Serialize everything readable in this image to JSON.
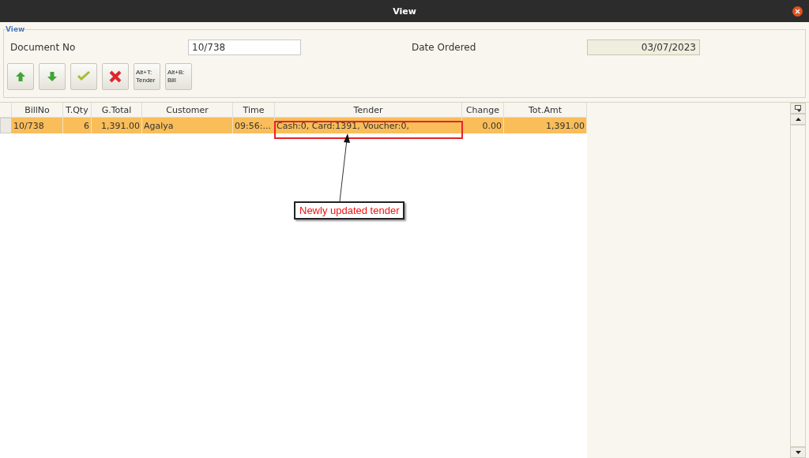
{
  "window": {
    "title": "View"
  },
  "group": {
    "title": "View"
  },
  "fields": [
    {
      "label": "Document No",
      "value": "10/738",
      "kind": "editable"
    },
    {
      "label": "Date Ordered",
      "value": "03/07/2023",
      "kind": "readonly"
    }
  ],
  "buttons": [
    {
      "kind": "up"
    },
    {
      "kind": "down"
    },
    {
      "kind": "ok"
    },
    {
      "kind": "cancel"
    },
    {
      "kind": "text",
      "lines": [
        "Alt+T:",
        "Tender"
      ]
    },
    {
      "kind": "text",
      "lines": [
        "Alt+B:",
        "Bill"
      ]
    }
  ],
  "table": {
    "columns": [
      {
        "label": "BillNo"
      },
      {
        "label": "T.Qty"
      },
      {
        "label": "G.Total"
      },
      {
        "label": "Customer"
      },
      {
        "label": "Time"
      },
      {
        "label": "Tender"
      },
      {
        "label": "Change"
      },
      {
        "label": "Tot.Amt"
      }
    ],
    "rows": [
      {
        "selected": true,
        "cells": [
          "10/738",
          "6",
          "1,391.00",
          "Agalya",
          "09:56:...",
          "Cash:0, Card:1391, Voucher:0,",
          "0.00",
          "1,391.00"
        ]
      }
    ]
  },
  "annotation": {
    "text": "Newly updated tender"
  }
}
